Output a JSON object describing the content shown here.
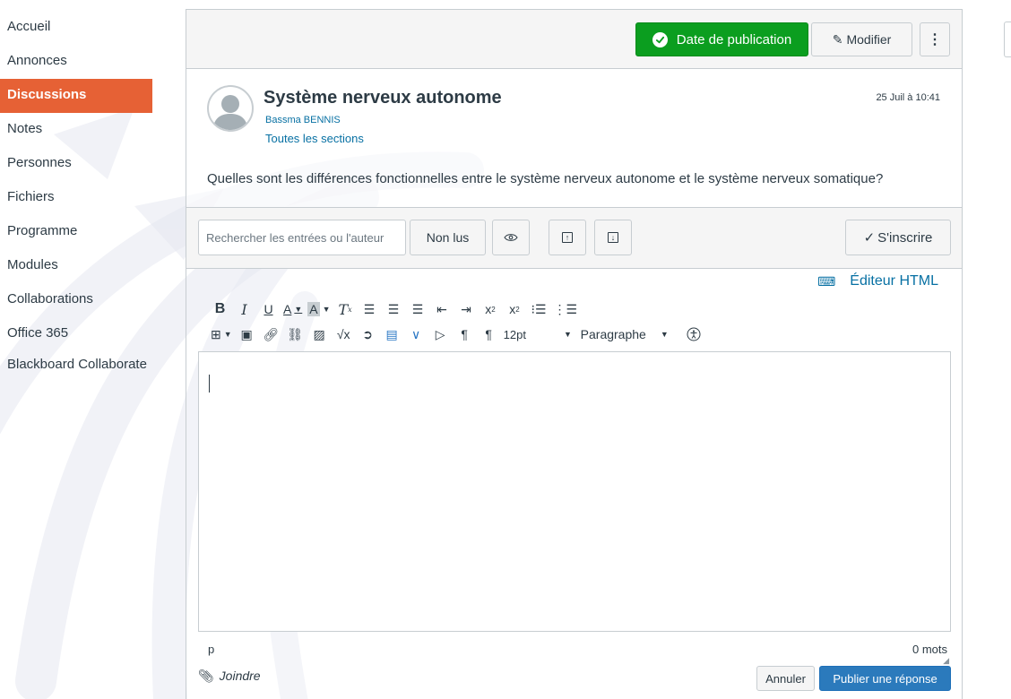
{
  "course_nav": {
    "items": [
      {
        "label": "Accueil"
      },
      {
        "label": "Annonces"
      },
      {
        "label": "Discussions",
        "active": true
      },
      {
        "label": "Notes"
      },
      {
        "label": "Personnes"
      },
      {
        "label": "Fichiers"
      },
      {
        "label": "Programme"
      },
      {
        "label": "Modules"
      },
      {
        "label": "Collaborations"
      },
      {
        "label": "Office 365"
      },
      {
        "label": "Blackboard Collaborate"
      }
    ],
    "active_color": "#e66135"
  },
  "topbar": {
    "publish_label": "Date de publication",
    "edit_label": "Modifier",
    "more_label": "⋮",
    "publish_color": "#0b9e1f"
  },
  "post": {
    "title": "Système nerveux autonome",
    "author": "Bassma BENNIS",
    "sections": "Toutes les sections",
    "date": "25 Juil à 10:41",
    "body": "Quelles sont les différences fonctionnelles entre le système nerveux autonome et le système nerveux somatique?"
  },
  "toolbar": {
    "search_placeholder": "Rechercher les entrées ou l'auteur",
    "unread_label": "Non lus",
    "subscribe_label": "S'inscrire",
    "icons": [
      "eye-icon",
      "scroll-up-icon",
      "scroll-down-icon"
    ]
  },
  "editor": {
    "html_editor_label": "Éditeur HTML",
    "font_size": "12pt",
    "block_format": "Paragraphe",
    "status_path": "p",
    "word_count": "0 mots"
  },
  "actions": {
    "attach_label": "Joindre",
    "cancel_label": "Annuler",
    "reply_label": "Publier une réponse",
    "reply_color": "#2b7abc"
  }
}
